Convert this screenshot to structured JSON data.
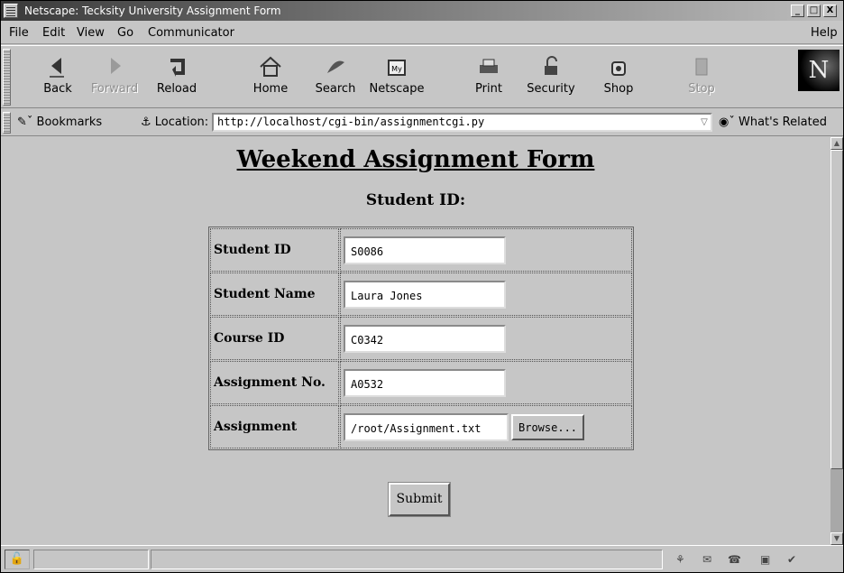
{
  "window": {
    "title": "Netscape: Tecksity University Assignment Form",
    "controls": {
      "minimize": "_",
      "maximize": "□",
      "close": "X"
    }
  },
  "menubar": {
    "items": [
      "File",
      "Edit",
      "View",
      "Go",
      "Communicator"
    ],
    "help": "Help"
  },
  "toolbar": {
    "buttons": [
      {
        "label": "Back",
        "icon": "back-arrow-icon",
        "enabled": true
      },
      {
        "label": "Forward",
        "icon": "forward-arrow-icon",
        "enabled": false
      },
      {
        "label": "Reload",
        "icon": "reload-icon",
        "enabled": true
      },
      {
        "label": "Home",
        "icon": "home-icon",
        "enabled": true
      },
      {
        "label": "Search",
        "icon": "search-icon",
        "enabled": true
      },
      {
        "label": "Netscape",
        "icon": "netscape-icon",
        "enabled": true
      },
      {
        "label": "Print",
        "icon": "print-icon",
        "enabled": true
      },
      {
        "label": "Security",
        "icon": "security-lock-icon",
        "enabled": true
      },
      {
        "label": "Shop",
        "icon": "shop-icon",
        "enabled": true
      },
      {
        "label": "Stop",
        "icon": "stop-icon",
        "enabled": false
      }
    ],
    "logo": "N"
  },
  "locationbar": {
    "bookmarks_label": "Bookmarks",
    "location_label": "Location:",
    "url": "http://localhost/cgi-bin/assignmentcgi.py",
    "related_label": "What's Related"
  },
  "page": {
    "title": "Weekend Assignment Form",
    "subtitle": "Student ID:",
    "fields": {
      "student_id": {
        "label": "Student ID",
        "value": "S0086"
      },
      "student_name": {
        "label": "Student Name",
        "value": "Laura Jones"
      },
      "course_id": {
        "label": "Course ID",
        "value": "C0342"
      },
      "assignment_no": {
        "label": "Assignment No.",
        "value": "A0532"
      },
      "assignment": {
        "label": "Assignment",
        "value": "/root/Assignment.txt",
        "browse_label": "Browse..."
      }
    },
    "submit_label": "Submit"
  }
}
